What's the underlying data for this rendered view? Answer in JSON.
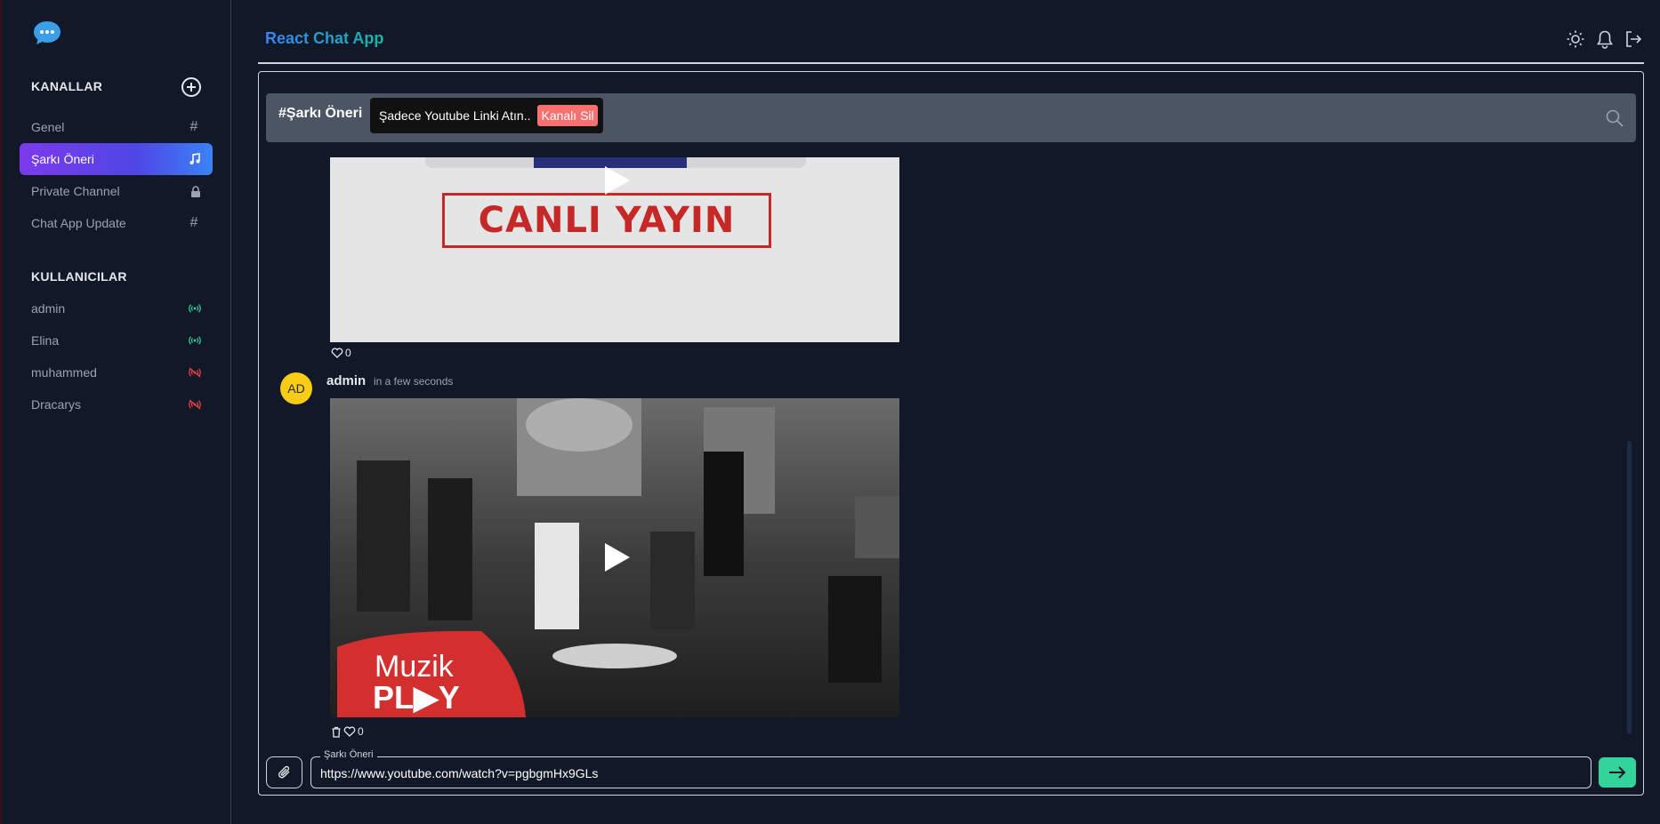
{
  "app": {
    "title": "React Chat App"
  },
  "sidebar": {
    "channels_title": "KANALLAR",
    "channels": [
      {
        "label": "Genel",
        "icon": "hash-icon"
      },
      {
        "label": "Şarkı Öneri",
        "icon": "music-note-icon",
        "active": true
      },
      {
        "label": "Private Channel",
        "icon": "lock-icon"
      },
      {
        "label": "Chat App Update",
        "icon": "hash-icon"
      }
    ],
    "users_title": "KULLANICILAR",
    "users": [
      {
        "name": "admin",
        "status": "online"
      },
      {
        "name": "Elina",
        "status": "online"
      },
      {
        "name": "muhammed",
        "status": "offline"
      },
      {
        "name": "Dracarys",
        "status": "offline"
      }
    ]
  },
  "channel": {
    "name": "#Şarkı Öneri",
    "description": "Şadece Youtube Linki Atın..",
    "delete_label": "Kanalı Sil"
  },
  "messages": [
    {
      "thumbnail_text": "CANLI YAYIN",
      "likes": "0"
    },
    {
      "author": "admin",
      "avatar": "AD",
      "time": "in a few seconds",
      "thumbnail_text_1": "Muzik",
      "thumbnail_text_2": "PL▶Y",
      "likes": "0"
    }
  ],
  "composer": {
    "label": "Şarkı Öneri",
    "value": "https://www.youtube.com/watch?v=pgbgmHx9GLs"
  },
  "colors": {
    "background": "#111827",
    "accent_gradient_start": "#7c3aed",
    "accent_gradient_end": "#3b82f6",
    "online": "#34d399",
    "offline": "#ef4444",
    "send": "#34d399",
    "delete": "#f87171",
    "avatar": "#facc15"
  }
}
